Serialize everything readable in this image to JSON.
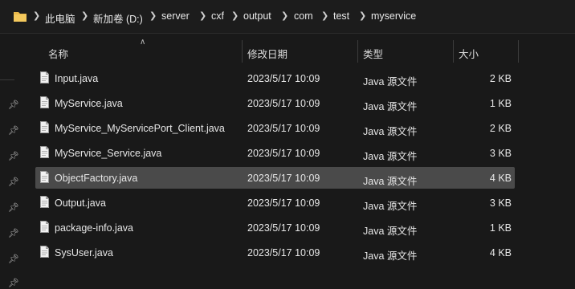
{
  "address": {
    "segments": [
      "此电脑",
      "新加卷 (D:)",
      "server",
      "cxf",
      "output",
      "com",
      "test",
      "myservice"
    ],
    "colors": {
      "folder": "#e8b84a"
    }
  },
  "columns": {
    "name": "名称",
    "date": "修改日期",
    "type": "类型",
    "size": "大小"
  },
  "files": [
    {
      "name": "Input.java",
      "date": "2023/5/17 10:09",
      "type": "Java 源文件",
      "size": "2 KB"
    },
    {
      "name": "MyService.java",
      "date": "2023/5/17 10:09",
      "type": "Java 源文件",
      "size": "1 KB"
    },
    {
      "name": "MyService_MyServicePort_Client.java",
      "date": "2023/5/17 10:09",
      "type": "Java 源文件",
      "size": "2 KB"
    },
    {
      "name": "MyService_Service.java",
      "date": "2023/5/17 10:09",
      "type": "Java 源文件",
      "size": "3 KB"
    },
    {
      "name": "ObjectFactory.java",
      "date": "2023/5/17 10:09",
      "type": "Java 源文件",
      "size": "4 KB",
      "selected": true
    },
    {
      "name": "Output.java",
      "date": "2023/5/17 10:09",
      "type": "Java 源文件",
      "size": "3 KB"
    },
    {
      "name": "package-info.java",
      "date": "2023/5/17 10:09",
      "type": "Java 源文件",
      "size": "1 KB"
    },
    {
      "name": "SysUser.java",
      "date": "2023/5/17 10:09",
      "type": "Java 源文件",
      "size": "4 KB"
    }
  ],
  "icons": {
    "folder": "folder-icon",
    "file": "document-icon",
    "pin": "pin-icon",
    "chevron": "chevron-right-icon",
    "sort": "sort-up-icon"
  }
}
